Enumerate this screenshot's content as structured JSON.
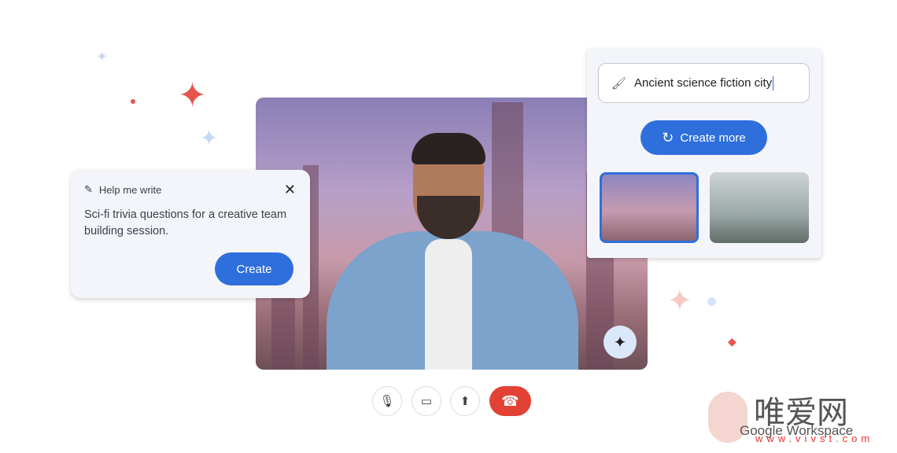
{
  "help_me_write": {
    "title": "Help me write",
    "text": "Sci-fi trivia questions for a creative team building session.",
    "create_label": "Create",
    "close_glyph": "✕",
    "icon": "magic-pen-icon"
  },
  "image_gen": {
    "prompt": "Ancient science fiction city",
    "create_more_label": "Create more",
    "icon": "brush-icon",
    "selected_thumbnail": 1
  },
  "call_controls": {
    "mic": "🎙",
    "camera": "▭",
    "present": "⬆",
    "end": "☎"
  },
  "watermark": {
    "cn": "唯爱网",
    "brand": "Google Workspace",
    "url": "www.vivst.com"
  },
  "colors": {
    "accent": "#2f6fdc",
    "end_call": "#e34134",
    "star_red": "#e8544c",
    "star_blue": "#c8d8f4"
  }
}
